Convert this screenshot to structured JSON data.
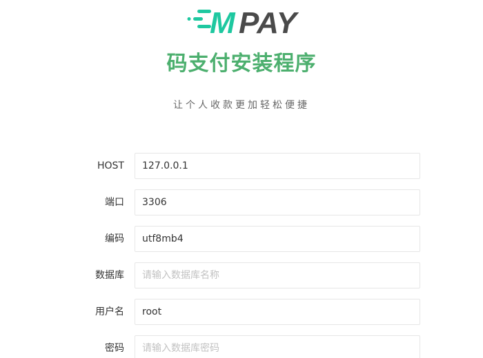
{
  "logo": {
    "text_m": "M",
    "text_pay": "PAY",
    "colors": {
      "accent": "#1ec8a0",
      "dark": "#4a4a4a"
    }
  },
  "title": "码支付安装程序",
  "subtitle": "让个人收款更加轻松便捷",
  "colors": {
    "title": "#4caf6e"
  },
  "form": {
    "fields": [
      {
        "label": "HOST",
        "value": "127.0.0.1",
        "placeholder": ""
      },
      {
        "label": "端口",
        "value": "3306",
        "placeholder": ""
      },
      {
        "label": "编码",
        "value": "utf8mb4",
        "placeholder": ""
      },
      {
        "label": "数据库",
        "value": "",
        "placeholder": "请输入数据库名称"
      },
      {
        "label": "用户名",
        "value": "root",
        "placeholder": ""
      },
      {
        "label": "密码",
        "value": "",
        "placeholder": "请输入数据库密码"
      }
    ]
  }
}
